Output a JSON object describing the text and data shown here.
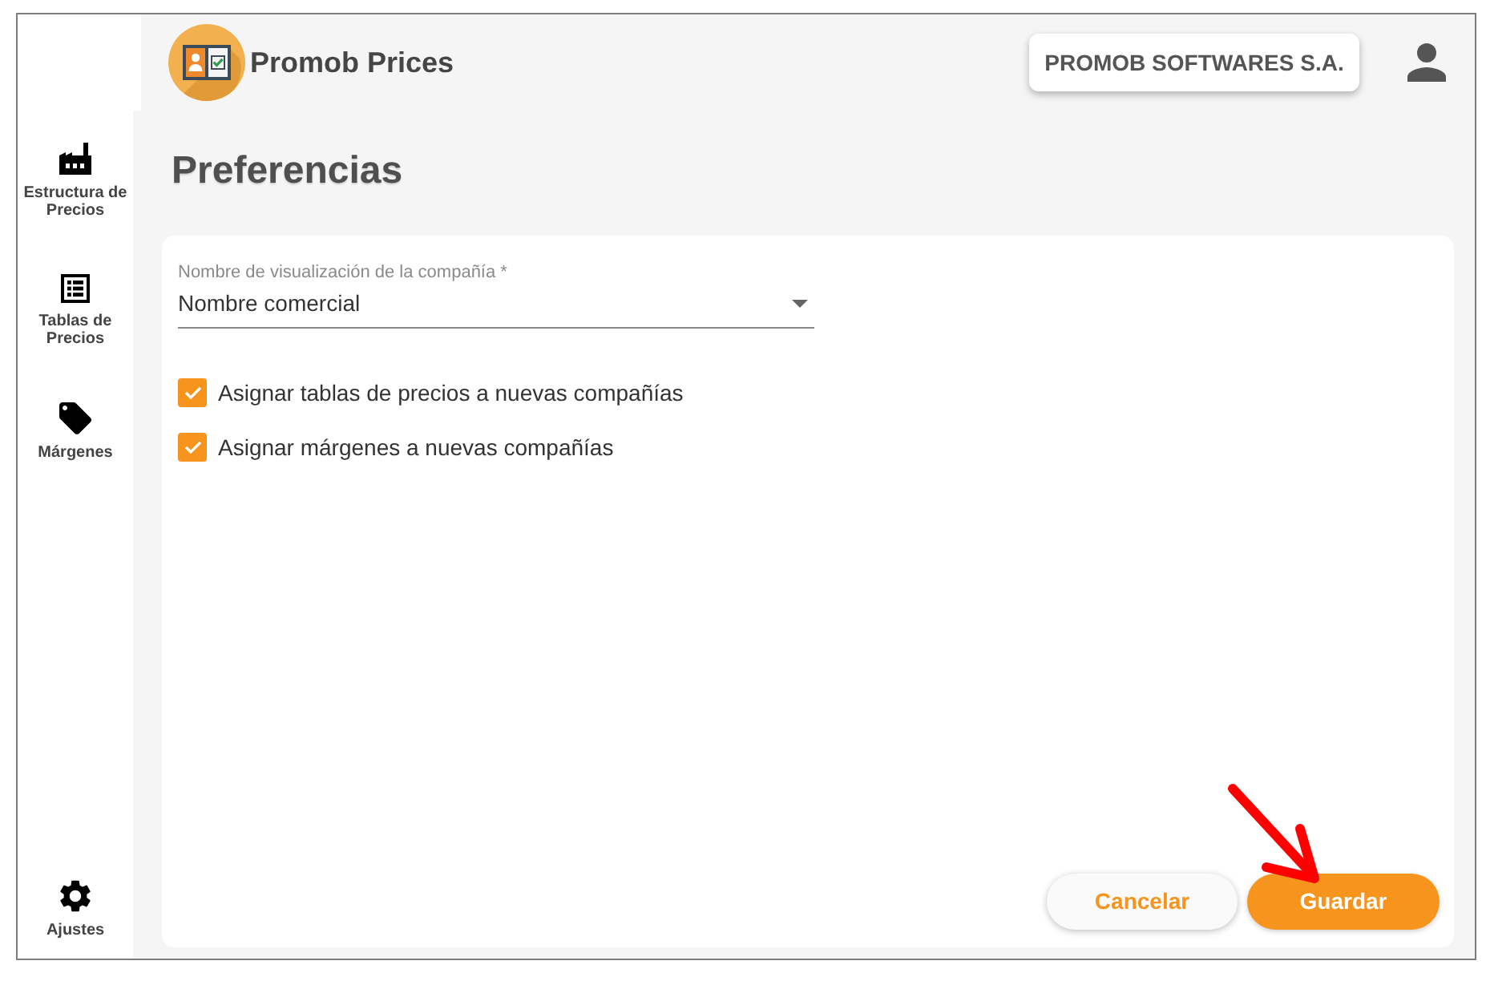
{
  "header": {
    "app_title": "Promob Prices",
    "company_button": "PROMOB SOFTWARES S.A."
  },
  "sidebar": {
    "items": [
      {
        "kind": "factory",
        "label": "Estructura de Precios"
      },
      {
        "kind": "list",
        "label": "Tablas de Precios"
      },
      {
        "kind": "tag",
        "label": "Márgenes"
      }
    ],
    "footer_item": {
      "kind": "gear",
      "label": "Ajustes"
    }
  },
  "page_title": "Preferencias",
  "form": {
    "select": {
      "label": "Nombre de visualización de la compañía *",
      "value": "Nombre comercial"
    },
    "checkboxes": [
      {
        "label": "Asignar tablas de precios a nuevas compañías",
        "checked": true
      },
      {
        "label": "Asignar márgenes a nuevas compañías",
        "checked": true
      }
    ]
  },
  "buttons": [
    {
      "kind": "secondary",
      "label": "Cancelar"
    },
    {
      "kind": "primary",
      "label": "Guardar"
    }
  ]
}
